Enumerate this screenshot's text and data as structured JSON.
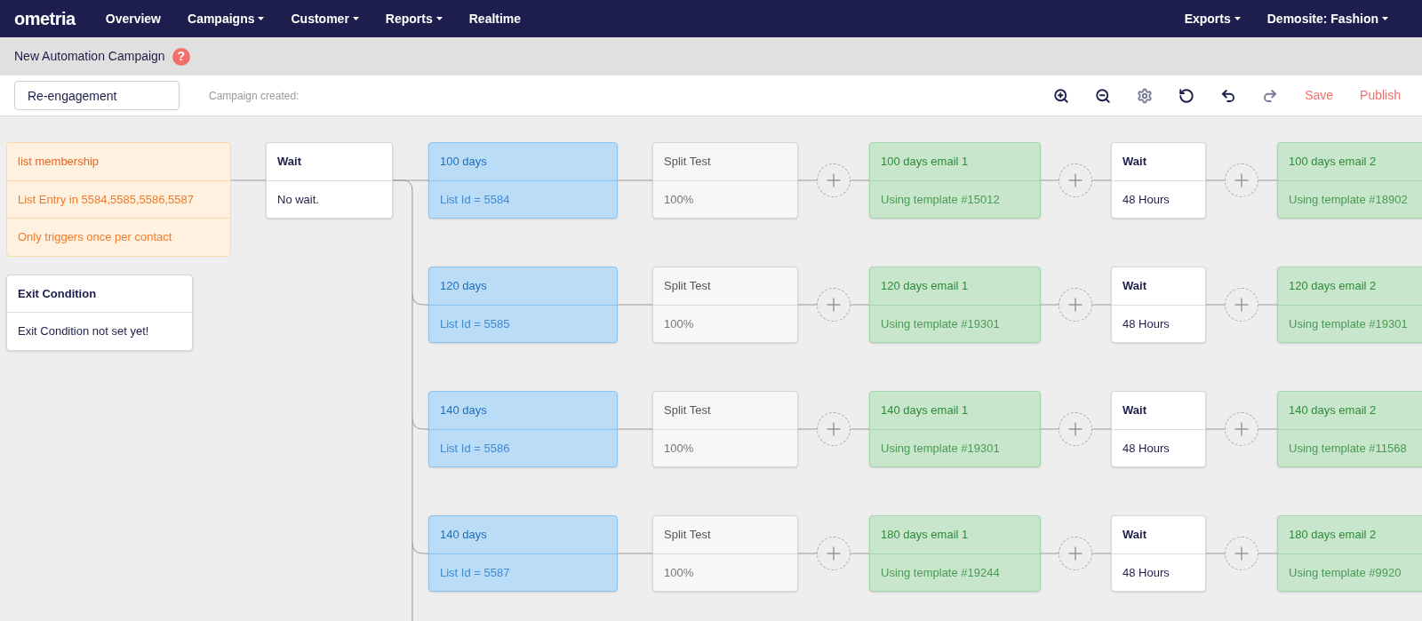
{
  "nav": {
    "logo": "ometria",
    "items": [
      {
        "label": "Overview",
        "has_menu": false
      },
      {
        "label": "Campaigns",
        "has_menu": true
      },
      {
        "label": "Customer",
        "has_menu": true
      },
      {
        "label": "Reports",
        "has_menu": true
      },
      {
        "label": "Realtime",
        "has_menu": false
      }
    ],
    "right_items": [
      {
        "label": "Exports",
        "has_menu": true
      },
      {
        "label": "Demosite: Fashion",
        "has_menu": true
      }
    ]
  },
  "title_bar": {
    "title": "New Automation Campaign",
    "help": "?"
  },
  "toolbar": {
    "campaign_name": "Re-engagement",
    "status": "Campaign created:",
    "tools": [
      {
        "kind": "zoom_in",
        "disabled": false
      },
      {
        "kind": "zoom_out",
        "disabled": false
      },
      {
        "kind": "settings",
        "disabled": true
      },
      {
        "kind": "history",
        "disabled": false
      },
      {
        "kind": "undo",
        "disabled": false
      },
      {
        "kind": "redo",
        "disabled": true
      }
    ],
    "actions": [
      "Save",
      "Publish"
    ]
  },
  "canvas": {
    "trigger": {
      "title": "list membership",
      "lines": [
        "List Entry in 5584,5585,5586,5587",
        "Only triggers once per contact"
      ]
    },
    "exit_condition": {
      "title": "Exit Condition",
      "body": "Exit Condition not set yet!"
    },
    "first_wait": {
      "title": "Wait",
      "body": "No wait."
    },
    "branches": [
      {
        "nodes": [
          {
            "kind": "segment",
            "title": "100 days",
            "body": "List Id = 5584"
          },
          {
            "kind": "split",
            "title": "Split Test",
            "body": "100%"
          },
          {
            "kind": "email",
            "title": "100 days email 1",
            "body": "Using template #15012"
          },
          {
            "kind": "wait",
            "title": "Wait",
            "body": "48 Hours"
          },
          {
            "kind": "email",
            "title": "100 days email 2",
            "body": "Using template #18902"
          }
        ]
      },
      {
        "nodes": [
          {
            "kind": "segment",
            "title": "120 days",
            "body": "List Id = 5585"
          },
          {
            "kind": "split",
            "title": "Split Test",
            "body": "100%"
          },
          {
            "kind": "email",
            "title": "120 days email 1",
            "body": "Using template #19301"
          },
          {
            "kind": "wait",
            "title": "Wait",
            "body": "48 Hours"
          },
          {
            "kind": "email",
            "title": "120 days email 2",
            "body": "Using template #19301"
          }
        ]
      },
      {
        "nodes": [
          {
            "kind": "segment",
            "title": "140 days",
            "body": "List Id = 5586"
          },
          {
            "kind": "split",
            "title": "Split Test",
            "body": "100%"
          },
          {
            "kind": "email",
            "title": "140 days email 1",
            "body": "Using template #19301"
          },
          {
            "kind": "wait",
            "title": "Wait",
            "body": "48 Hours"
          },
          {
            "kind": "email",
            "title": "140 days email 2",
            "body": "Using template #11568"
          }
        ]
      },
      {
        "nodes": [
          {
            "kind": "segment",
            "title": "140 days",
            "body": "List Id = 5587"
          },
          {
            "kind": "split",
            "title": "Split Test",
            "body": "100%"
          },
          {
            "kind": "email",
            "title": "180 days email 1",
            "body": "Using template #19244"
          },
          {
            "kind": "wait",
            "title": "Wait",
            "body": "48 Hours"
          },
          {
            "kind": "email",
            "title": "180 days email 2",
            "body": "Using template #9920"
          }
        ]
      }
    ]
  }
}
